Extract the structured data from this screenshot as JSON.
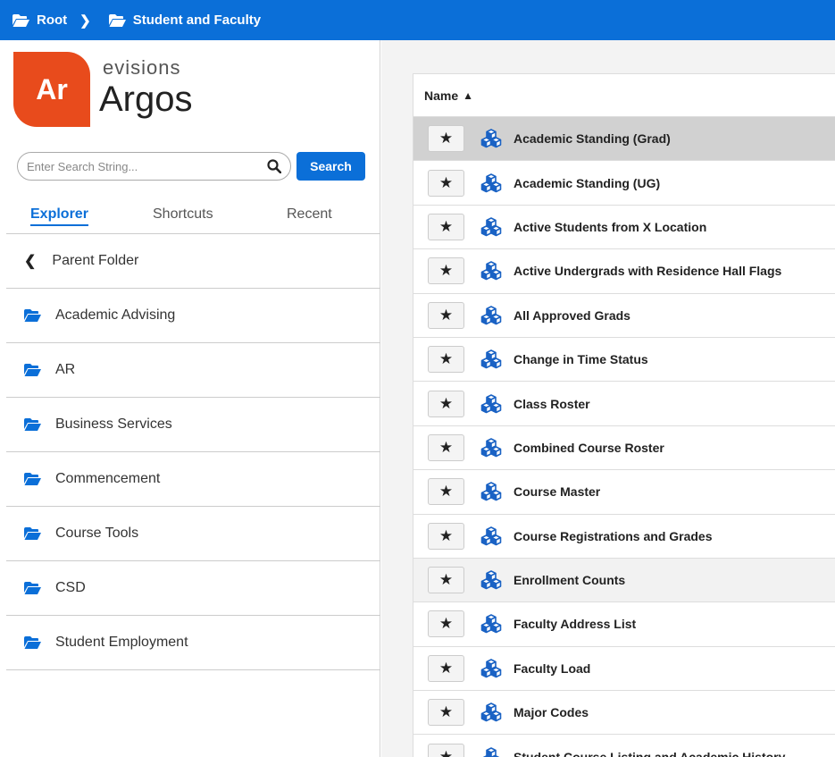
{
  "breadcrumb": {
    "root": "Root",
    "current": "Student and Faculty",
    "folder_icon": "folder-open-icon",
    "separator_icon": "chevron-right-icon"
  },
  "brand": {
    "logo_text": "Ar",
    "company": "evisions",
    "product": "Argos",
    "logo_color": "#e84b1c"
  },
  "search": {
    "placeholder": "Enter Search String...",
    "button_label": "Search"
  },
  "tabs": {
    "explorer": "Explorer",
    "shortcuts": "Shortcuts",
    "recent": "Recent"
  },
  "nav": {
    "parent": "Parent Folder",
    "folders": [
      "Academic Advising",
      "AR",
      "Business Services",
      "Commencement",
      "Course Tools",
      "CSD",
      "Student Employment"
    ]
  },
  "table": {
    "header": "Name",
    "sort_icon": "sort-asc-icon",
    "star_icon": "star-icon",
    "row_icon": "cubes-icon",
    "rows": [
      "Academic Standing (Grad)",
      "Academic Standing (UG)",
      "Active Students from X Location",
      "Active Undergrads with Residence Hall Flags",
      "All Approved Grads",
      "Change in Time Status",
      "Class Roster",
      "Combined Course Roster",
      "Course Master",
      "Course Registrations and Grades",
      "Enrollment Counts",
      "Faculty Address List",
      "Faculty Load",
      "Major Codes",
      "Student Course Listing and Academic History"
    ]
  },
  "colors": {
    "accent": "#0b6fd8",
    "selected_row": "#d1d1d1"
  }
}
